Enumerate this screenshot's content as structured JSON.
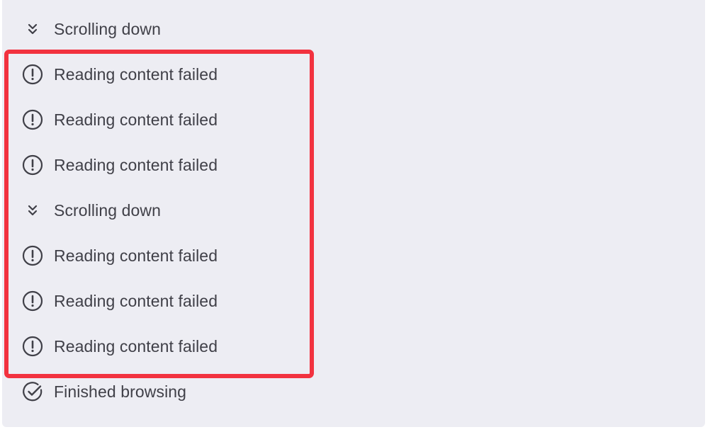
{
  "steps": [
    {
      "icon": "chevrons-down-icon",
      "label": "Scrolling down"
    },
    {
      "icon": "alert-circle-icon",
      "label": "Reading content failed"
    },
    {
      "icon": "alert-circle-icon",
      "label": "Reading content failed"
    },
    {
      "icon": "alert-circle-icon",
      "label": "Reading content failed"
    },
    {
      "icon": "chevrons-down-icon",
      "label": "Scrolling down"
    },
    {
      "icon": "alert-circle-icon",
      "label": "Reading content failed"
    },
    {
      "icon": "alert-circle-icon",
      "label": "Reading content failed"
    },
    {
      "icon": "alert-circle-icon",
      "label": "Reading content failed"
    },
    {
      "icon": "check-circle-icon",
      "label": "Finished browsing"
    }
  ],
  "colors": {
    "panel_background": "#ededf3",
    "text": "#404048",
    "highlight_border": "#f2323f"
  }
}
